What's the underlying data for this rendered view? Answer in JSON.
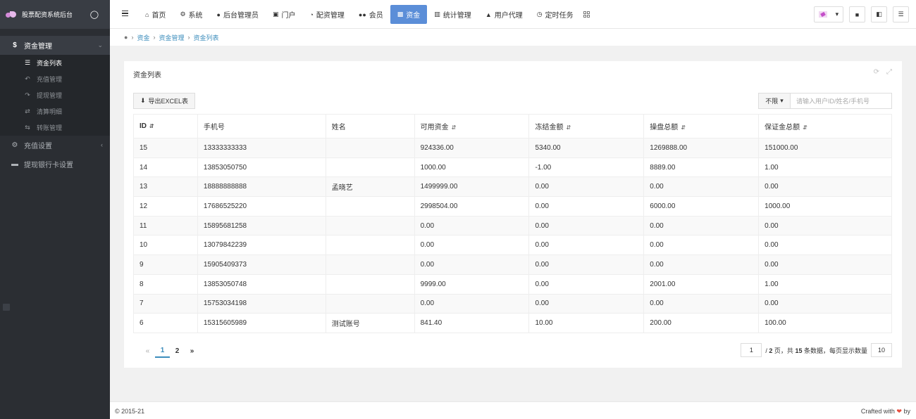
{
  "brand": {
    "name": "股票配资系统后台",
    "drop_icon": "water-drop-icon"
  },
  "sidebar": {
    "menus": [
      {
        "label": "资金管理",
        "icon": "dollar-icon",
        "active": true,
        "children": [
          {
            "label": "资金列表",
            "icon": "list-icon",
            "active": true
          },
          {
            "label": "充值管理",
            "icon": "reply-icon"
          },
          {
            "label": "提现管理",
            "icon": "share-icon"
          },
          {
            "label": "清算明细",
            "icon": "shuffle-icon"
          },
          {
            "label": "转账管理",
            "icon": "exchange-icon"
          }
        ]
      },
      {
        "label": "充值设置",
        "icon": "gear-icon"
      },
      {
        "label": "提现银行卡设置",
        "icon": "card-icon"
      }
    ]
  },
  "nav": {
    "items": [
      {
        "label": "首页",
        "icon": "home-icon"
      },
      {
        "label": "系统",
        "icon": "gear-icon"
      },
      {
        "label": "后台管理员",
        "icon": "user-icon"
      },
      {
        "label": "门户",
        "icon": "portal-icon"
      },
      {
        "label": "配资管理",
        "icon": "pie-icon"
      },
      {
        "label": "会员",
        "icon": "users-icon"
      },
      {
        "label": "资金",
        "icon": "money-icon",
        "active": true
      },
      {
        "label": "统计管理",
        "icon": "bar-chart-icon"
      },
      {
        "label": "用户代理",
        "icon": "sitemap-icon"
      },
      {
        "label": "定时任务",
        "icon": "clock-icon"
      }
    ]
  },
  "breadcrumb": [
    "资金",
    "资金管理",
    "资金列表"
  ],
  "panel": {
    "title": "资金列表",
    "export_label": "导出EXCEL表",
    "filter_label": "不限",
    "search_placeholder": "请输入用户ID/姓名/手机号"
  },
  "table": {
    "columns": [
      "ID",
      "手机号",
      "姓名",
      "可用资金",
      "冻结金额",
      "操盘总额",
      "保证金总额"
    ],
    "rows": [
      {
        "id": "15",
        "phone": "13333333333",
        "name": "",
        "available": "924336.00",
        "frozen": "5340.00",
        "trade_total": "1269888.00",
        "deposit_total": "151000.00"
      },
      {
        "id": "14",
        "phone": "13853050750",
        "name": "",
        "available": "1000.00",
        "frozen": "-1.00",
        "trade_total": "8889.00",
        "deposit_total": "1.00"
      },
      {
        "id": "13",
        "phone": "18888888888",
        "name": "孟晓艺",
        "available": "1499999.00",
        "frozen": "0.00",
        "trade_total": "0.00",
        "deposit_total": "0.00"
      },
      {
        "id": "12",
        "phone": "17686525220",
        "name": "",
        "available": "2998504.00",
        "frozen": "0.00",
        "trade_total": "6000.00",
        "deposit_total": "1000.00"
      },
      {
        "id": "11",
        "phone": "15895681258",
        "name": "",
        "available": "0.00",
        "frozen": "0.00",
        "trade_total": "0.00",
        "deposit_total": "0.00"
      },
      {
        "id": "10",
        "phone": "13079842239",
        "name": "",
        "available": "0.00",
        "frozen": "0.00",
        "trade_total": "0.00",
        "deposit_total": "0.00"
      },
      {
        "id": "9",
        "phone": "15905409373",
        "name": "",
        "available": "0.00",
        "frozen": "0.00",
        "trade_total": "0.00",
        "deposit_total": "0.00"
      },
      {
        "id": "8",
        "phone": "13853050748",
        "name": "",
        "available": "9999.00",
        "frozen": "0.00",
        "trade_total": "2001.00",
        "deposit_total": "1.00"
      },
      {
        "id": "7",
        "phone": "15753034198",
        "name": "",
        "available": "0.00",
        "frozen": "0.00",
        "trade_total": "0.00",
        "deposit_total": "0.00"
      },
      {
        "id": "6",
        "phone": "15315605989",
        "name": "测试账号",
        "available": "841.40",
        "frozen": "10.00",
        "trade_total": "200.00",
        "deposit_total": "100.00"
      }
    ]
  },
  "pagination": {
    "prev": "«",
    "pages": [
      "1",
      "2"
    ],
    "current": "1",
    "next": "»",
    "current_input": "1",
    "total_pages": "2",
    "total_items": "15",
    "page_size": "10",
    "text_slash": "/",
    "text_pages": "页，共",
    "text_items": "条数据，每页显示数量"
  },
  "footer": {
    "copyright": "© 2015-21",
    "crafted": "Crafted with",
    "by": "by"
  }
}
